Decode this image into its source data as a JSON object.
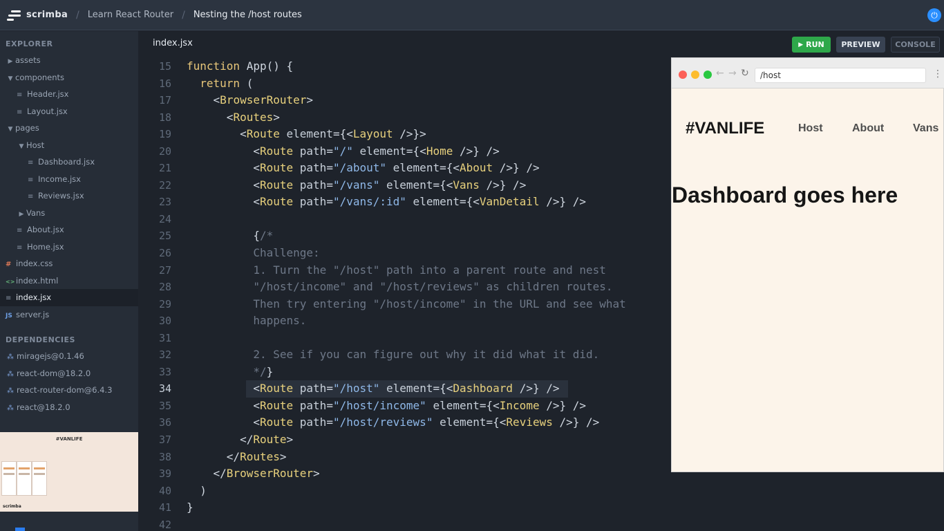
{
  "topbar": {
    "brand": "scrimba",
    "course": "Learn React Router",
    "lesson": "Nesting the /host routes",
    "power_icon": "power-icon"
  },
  "explorer": {
    "title": "EXPLORER",
    "items": [
      {
        "label": "assets",
        "kind": "folder",
        "open": false,
        "depth": 0
      },
      {
        "label": "components",
        "kind": "folder",
        "open": true,
        "depth": 0
      },
      {
        "label": "Header.jsx",
        "kind": "file",
        "depth": 1
      },
      {
        "label": "Layout.jsx",
        "kind": "file",
        "depth": 1
      },
      {
        "label": "pages",
        "kind": "folder",
        "open": true,
        "depth": 0
      },
      {
        "label": "Host",
        "kind": "folder",
        "open": true,
        "depth": 1
      },
      {
        "label": "Dashboard.jsx",
        "kind": "file",
        "depth": 2
      },
      {
        "label": "Income.jsx",
        "kind": "file",
        "depth": 2
      },
      {
        "label": "Reviews.jsx",
        "kind": "file",
        "depth": 2
      },
      {
        "label": "Vans",
        "kind": "folder",
        "open": false,
        "depth": 1
      },
      {
        "label": "About.jsx",
        "kind": "file",
        "depth": 1
      },
      {
        "label": "Home.jsx",
        "kind": "file",
        "depth": 1
      },
      {
        "label": "index.css",
        "kind": "css",
        "depth": 0
      },
      {
        "label": "index.html",
        "kind": "html",
        "depth": 0
      },
      {
        "label": "index.jsx",
        "kind": "file",
        "depth": 0,
        "active": true
      },
      {
        "label": "server.js",
        "kind": "js",
        "depth": 0
      }
    ]
  },
  "dependencies": {
    "title": "DEPENDENCIES",
    "items": [
      "miragejs@0.1.46",
      "react-dom@18.2.0",
      "react-router-dom@6.4.3",
      "react@18.2.0"
    ]
  },
  "thumbnail": {
    "title": "#VANLIFE",
    "footer": "scrimba"
  },
  "editor": {
    "tab": "index.jsx",
    "run_label": "RUN",
    "preview_label": "PREVIEW",
    "console_label": "CONSOLE",
    "highlighted_line": 34,
    "lines": [
      {
        "n": "15",
        "tokens": [
          [
            "kw",
            "function "
          ],
          [
            "pl",
            "App() {"
          ]
        ]
      },
      {
        "n": "16",
        "tokens": [
          [
            "pl",
            "  "
          ],
          [
            "kw",
            "return"
          ],
          [
            "pl",
            " ("
          ]
        ]
      },
      {
        "n": "17",
        "tokens": [
          [
            "pl",
            "    <"
          ],
          [
            "tg",
            "BrowserRouter"
          ],
          [
            "pl",
            ">"
          ]
        ]
      },
      {
        "n": "18",
        "tokens": [
          [
            "pl",
            "      <"
          ],
          [
            "tg",
            "Routes"
          ],
          [
            "pl",
            ">"
          ]
        ]
      },
      {
        "n": "19",
        "tokens": [
          [
            "pl",
            "        <"
          ],
          [
            "tg",
            "Route"
          ],
          [
            "at",
            " element"
          ],
          [
            "pl",
            "={<"
          ],
          [
            "tg",
            "Layout"
          ],
          [
            "pl",
            " />}>"
          ]
        ]
      },
      {
        "n": "20",
        "tokens": [
          [
            "pl",
            "          <"
          ],
          [
            "tg",
            "Route"
          ],
          [
            "at",
            " path"
          ],
          [
            "pl",
            "="
          ],
          [
            "st",
            "\"/\""
          ],
          [
            "at",
            " element"
          ],
          [
            "pl",
            "={<"
          ],
          [
            "tg",
            "Home"
          ],
          [
            "pl",
            " />} />"
          ]
        ]
      },
      {
        "n": "21",
        "tokens": [
          [
            "pl",
            "          <"
          ],
          [
            "tg",
            "Route"
          ],
          [
            "at",
            " path"
          ],
          [
            "pl",
            "="
          ],
          [
            "st",
            "\"/about\""
          ],
          [
            "at",
            " element"
          ],
          [
            "pl",
            "={<"
          ],
          [
            "tg",
            "About"
          ],
          [
            "pl",
            " />} />"
          ]
        ]
      },
      {
        "n": "22",
        "tokens": [
          [
            "pl",
            "          <"
          ],
          [
            "tg",
            "Route"
          ],
          [
            "at",
            " path"
          ],
          [
            "pl",
            "="
          ],
          [
            "st",
            "\"/vans\""
          ],
          [
            "at",
            " element"
          ],
          [
            "pl",
            "={<"
          ],
          [
            "tg",
            "Vans"
          ],
          [
            "pl",
            " />} />"
          ]
        ]
      },
      {
        "n": "23",
        "tokens": [
          [
            "pl",
            "          <"
          ],
          [
            "tg",
            "Route"
          ],
          [
            "at",
            " path"
          ],
          [
            "pl",
            "="
          ],
          [
            "st",
            "\"/vans/:id\""
          ],
          [
            "at",
            " element"
          ],
          [
            "pl",
            "={<"
          ],
          [
            "tg",
            "VanDetail"
          ],
          [
            "pl",
            " />} />"
          ]
        ]
      },
      {
        "n": "24",
        "tokens": []
      },
      {
        "n": "25",
        "tokens": [
          [
            "pl",
            "          {"
          ],
          [
            "cm",
            "/*"
          ]
        ]
      },
      {
        "n": "26",
        "tokens": [
          [
            "cm",
            "          Challenge:"
          ]
        ]
      },
      {
        "n": "27",
        "tokens": [
          [
            "cm",
            "          1. Turn the \"/host\" path into a parent route and nest"
          ]
        ]
      },
      {
        "n": "28",
        "tokens": [
          [
            "cm",
            "          \"/host/income\" and \"/host/reviews\" as children routes."
          ]
        ]
      },
      {
        "n": "29",
        "tokens": [
          [
            "cm",
            "          Then try entering \"/host/income\" in the URL and see what"
          ]
        ]
      },
      {
        "n": "30",
        "tokens": [
          [
            "cm",
            "          happens."
          ]
        ]
      },
      {
        "n": "31",
        "tokens": []
      },
      {
        "n": "32",
        "tokens": [
          [
            "cm",
            "          2. See if you can figure out why it did what it did."
          ]
        ]
      },
      {
        "n": "33",
        "tokens": [
          [
            "cm",
            "          */"
          ],
          [
            "pl",
            "}"
          ]
        ]
      },
      {
        "n": "34",
        "tokens": [
          [
            "pl",
            "          <"
          ],
          [
            "tg",
            "Route"
          ],
          [
            "at",
            " path"
          ],
          [
            "pl",
            "="
          ],
          [
            "st",
            "\"/host\""
          ],
          [
            "at",
            " element"
          ],
          [
            "pl",
            "={<"
          ],
          [
            "tg",
            "Dashboard"
          ],
          [
            "pl",
            " />} />"
          ]
        ]
      },
      {
        "n": "35",
        "tokens": [
          [
            "pl",
            "          <"
          ],
          [
            "tg",
            "Route"
          ],
          [
            "at",
            " path"
          ],
          [
            "pl",
            "="
          ],
          [
            "st",
            "\"/host/income\""
          ],
          [
            "at",
            " element"
          ],
          [
            "pl",
            "={<"
          ],
          [
            "tg",
            "Income"
          ],
          [
            "pl",
            " />} />"
          ]
        ]
      },
      {
        "n": "36",
        "tokens": [
          [
            "pl",
            "          <"
          ],
          [
            "tg",
            "Route"
          ],
          [
            "at",
            " path"
          ],
          [
            "pl",
            "="
          ],
          [
            "st",
            "\"/host/reviews\""
          ],
          [
            "at",
            " element"
          ],
          [
            "pl",
            "={<"
          ],
          [
            "tg",
            "Reviews"
          ],
          [
            "pl",
            " />} />"
          ]
        ]
      },
      {
        "n": "37",
        "tokens": [
          [
            "pl",
            "        </"
          ],
          [
            "tg",
            "Route"
          ],
          [
            "pl",
            ">"
          ]
        ]
      },
      {
        "n": "38",
        "tokens": [
          [
            "pl",
            "      </"
          ],
          [
            "tg",
            "Routes"
          ],
          [
            "pl",
            ">"
          ]
        ]
      },
      {
        "n": "39",
        "tokens": [
          [
            "pl",
            "    </"
          ],
          [
            "tg",
            "BrowserRouter"
          ],
          [
            "pl",
            ">"
          ]
        ]
      },
      {
        "n": "40",
        "tokens": [
          [
            "pl",
            "  )"
          ]
        ]
      },
      {
        "n": "41",
        "tokens": [
          [
            "pl",
            "}"
          ]
        ]
      },
      {
        "n": "42",
        "tokens": []
      }
    ]
  },
  "preview": {
    "url": "/host",
    "brand": "#VANLIFE",
    "nav": [
      "Host",
      "About",
      "Vans"
    ],
    "heading": "Dashboard goes here"
  },
  "colors": {
    "run_green": "#2ea84a",
    "accent_blue": "#2b8fff",
    "preview_bg": "#fcf4ea"
  }
}
